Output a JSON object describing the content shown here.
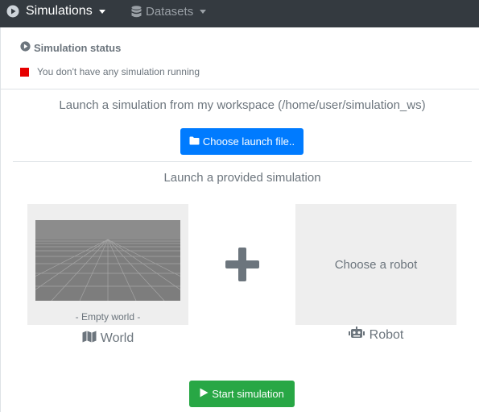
{
  "navbar": {
    "simulations": {
      "label": "Simulations",
      "icon": "play-circle-icon"
    },
    "datasets": {
      "label": "Datasets",
      "icon": "database-icon"
    }
  },
  "status": {
    "title": "Simulation status",
    "title_icon": "play-circle-icon",
    "message": "You don't have any simulation running",
    "indicator_color": "#e60000"
  },
  "workspace": {
    "heading": "Launch a simulation from my workspace (/home/user/simulation_ws)",
    "button_label": "Choose launch file..",
    "button_icon": "folder-icon"
  },
  "provided": {
    "heading": "Launch a provided simulation",
    "world": {
      "caption": "- Empty world -",
      "label": "World",
      "icon": "map-icon"
    },
    "combine_icon": "plus-icon",
    "robot": {
      "placeholder": "Choose a robot",
      "label": "Robot",
      "icon": "robot-icon"
    }
  },
  "actions": {
    "start_label": "Start simulation",
    "start_icon": "play-icon"
  },
  "colors": {
    "navbar": "#343a40",
    "primary": "#007bff",
    "success": "#28a745",
    "card": "#eeeeee"
  }
}
